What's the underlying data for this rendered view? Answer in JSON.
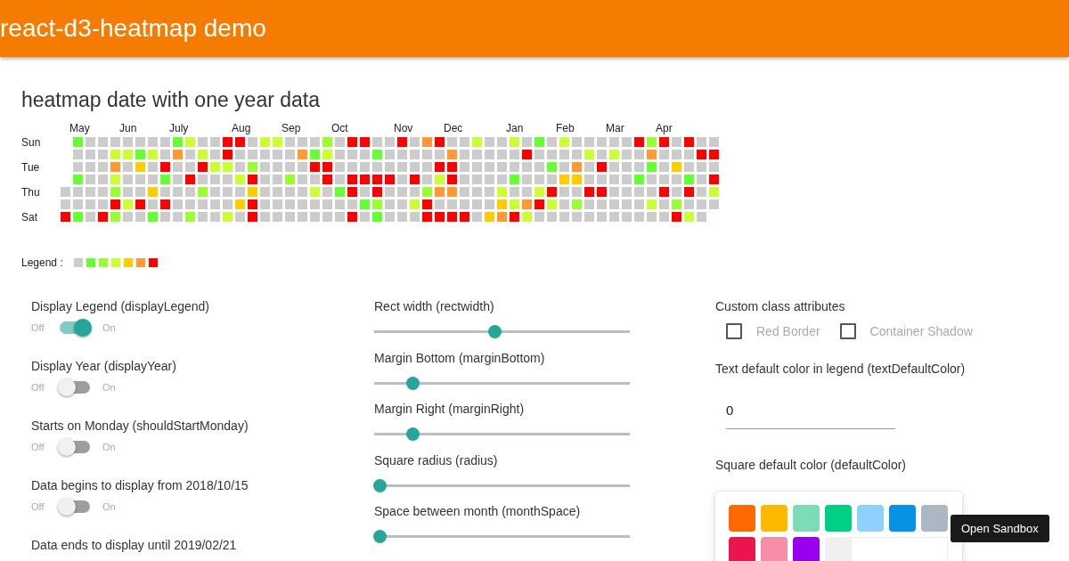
{
  "header": {
    "title": "react-d3-heatmap demo"
  },
  "section_title": "heatmap date with one year data",
  "heatmap": {
    "months": [
      {
        "label": "May"
      },
      {
        "label": "Jun"
      },
      {
        "label": "July"
      },
      {
        "label": "Aug"
      },
      {
        "label": "Sep"
      },
      {
        "label": "Oct"
      },
      {
        "label": "Nov"
      },
      {
        "label": "Dec"
      },
      {
        "label": "Jan"
      },
      {
        "label": "Feb"
      },
      {
        "label": "Mar"
      },
      {
        "label": "Apr"
      }
    ],
    "day_labels": [
      {
        "label": "Sun"
      },
      {
        "label": "Tue"
      },
      {
        "label": "Thu"
      },
      {
        "label": "Sat"
      }
    ],
    "rows": [
      {
        "cells": [
          {
            "color": "#66ff33"
          },
          {
            "color": "#cccccc"
          },
          {
            "color": "#cccccc"
          },
          {
            "color": "#cccccc"
          },
          {
            "color": "#cccccc"
          },
          {
            "color": "#cccccc"
          },
          {
            "color": "#cccccc"
          },
          {
            "color": "#cccccc"
          },
          {
            "color": "#66ff33"
          },
          {
            "color": "#ccff33"
          },
          {
            "color": "#cccccc"
          },
          {
            "color": "#cccccc"
          },
          {
            "color": "#ff0000"
          },
          {
            "color": "#ff0000"
          },
          {
            "color": "#cccccc"
          },
          {
            "color": "#ccff33"
          },
          {
            "color": "#ccff33"
          },
          {
            "color": "#cccccc"
          },
          {
            "color": "#cccccc"
          },
          {
            "color": "#cccccc"
          },
          {
            "color": "#99ff33"
          },
          {
            "color": "#cccccc"
          },
          {
            "color": "#ff0000"
          },
          {
            "color": "#ff0000"
          },
          {
            "color": "#cccccc"
          },
          {
            "color": "#cccccc"
          },
          {
            "color": "#ff0000"
          },
          {
            "color": "#cccccc"
          },
          {
            "color": "#ff9933"
          },
          {
            "color": "#ff0000"
          },
          {
            "color": "#cccccc"
          },
          {
            "color": "#cccccc"
          },
          {
            "color": "#ccff33"
          },
          {
            "color": "#cccccc"
          },
          {
            "color": "#cccccc"
          },
          {
            "color": "#ccff33"
          },
          {
            "color": "#cccccc"
          },
          {
            "color": "#66ff33"
          },
          {
            "color": "#cccccc"
          },
          {
            "color": "#ccff33"
          },
          {
            "color": "#cccccc"
          },
          {
            "color": "#cccccc"
          },
          {
            "color": "#cccccc"
          },
          {
            "color": "#cccccc"
          },
          {
            "color": "#cccccc"
          },
          {
            "color": "#ff0000"
          },
          {
            "color": "#99ff33"
          },
          {
            "color": "#ff0000"
          },
          {
            "color": "#cccccc"
          },
          {
            "color": "#ff0000"
          },
          {
            "color": "#cccccc"
          },
          {
            "color": "#cccccc"
          }
        ]
      },
      {
        "cells": [
          {
            "color": "#cccccc"
          },
          {
            "color": "#cccccc"
          },
          {
            "color": "#cccccc"
          },
          {
            "color": "#ccff33"
          },
          {
            "color": "#ccff33"
          },
          {
            "color": "#66ff33"
          },
          {
            "color": "#ccff33"
          },
          {
            "color": "#cccccc"
          },
          {
            "color": "#ff9933"
          },
          {
            "color": "#cccccc"
          },
          {
            "color": "#ccff33"
          },
          {
            "color": "#cccccc"
          },
          {
            "color": "#ff0000"
          },
          {
            "color": "#cccccc"
          },
          {
            "color": "#cccccc"
          },
          {
            "color": "#cccccc"
          },
          {
            "color": "#cccccc"
          },
          {
            "color": "#cccccc"
          },
          {
            "color": "#ff9933"
          },
          {
            "color": "#66ff33"
          },
          {
            "color": "#ccff33"
          },
          {
            "color": "#cccccc"
          },
          {
            "color": "#cccccc"
          },
          {
            "color": "#cccccc"
          },
          {
            "color": "#66ff33"
          },
          {
            "color": "#cccccc"
          },
          {
            "color": "#cccccc"
          },
          {
            "color": "#cccccc"
          },
          {
            "color": "#cccccc"
          },
          {
            "color": "#cccccc"
          },
          {
            "color": "#ff9933"
          },
          {
            "color": "#cccccc"
          },
          {
            "color": "#cccccc"
          },
          {
            "color": "#cccccc"
          },
          {
            "color": "#cccccc"
          },
          {
            "color": "#cccccc"
          },
          {
            "color": "#ff0000"
          },
          {
            "color": "#cccccc"
          },
          {
            "color": "#cccccc"
          },
          {
            "color": "#cccccc"
          },
          {
            "color": "#cccccc"
          },
          {
            "color": "#ccff33"
          },
          {
            "color": "#cccccc"
          },
          {
            "color": "#ccff33"
          },
          {
            "color": "#cccccc"
          },
          {
            "color": "#cccccc"
          },
          {
            "color": "#ff9933"
          },
          {
            "color": "#cccccc"
          },
          {
            "color": "#cccccc"
          },
          {
            "color": "#cccccc"
          },
          {
            "color": "#ff0000"
          },
          {
            "color": "#ff0000"
          }
        ]
      },
      {
        "cells": [
          {
            "color": "#cccccc"
          },
          {
            "color": "#cccccc"
          },
          {
            "color": "#cccccc"
          },
          {
            "color": "#ff9933"
          },
          {
            "color": "#cccccc"
          },
          {
            "color": "#ffcc00"
          },
          {
            "color": "#cccccc"
          },
          {
            "color": "#ff0000"
          },
          {
            "color": "#cccccc"
          },
          {
            "color": "#cccccc"
          },
          {
            "color": "#ff0000"
          },
          {
            "color": "#ccff33"
          },
          {
            "color": "#ccff33"
          },
          {
            "color": "#cccccc"
          },
          {
            "color": "#99ff33"
          },
          {
            "color": "#cccccc"
          },
          {
            "color": "#cccccc"
          },
          {
            "color": "#cccccc"
          },
          {
            "color": "#cccccc"
          },
          {
            "color": "#ff0000"
          },
          {
            "color": "#ff0000"
          },
          {
            "color": "#cccccc"
          },
          {
            "color": "#cccccc"
          },
          {
            "color": "#cccccc"
          },
          {
            "color": "#cccccc"
          },
          {
            "color": "#cccccc"
          },
          {
            "color": "#cccccc"
          },
          {
            "color": "#cccccc"
          },
          {
            "color": "#cccccc"
          },
          {
            "color": "#ff0000"
          },
          {
            "color": "#ff0000"
          },
          {
            "color": "#cccccc"
          },
          {
            "color": "#cccccc"
          },
          {
            "color": "#cccccc"
          },
          {
            "color": "#cccccc"
          },
          {
            "color": "#cccccc"
          },
          {
            "color": "#cccccc"
          },
          {
            "color": "#cccccc"
          },
          {
            "color": "#66ff33"
          },
          {
            "color": "#cccccc"
          },
          {
            "color": "#ff9933"
          },
          {
            "color": "#cccccc"
          },
          {
            "color": "#ff0000"
          },
          {
            "color": "#cccccc"
          },
          {
            "color": "#cccccc"
          },
          {
            "color": "#cccccc"
          },
          {
            "color": "#66ff33"
          },
          {
            "color": "#cccccc"
          },
          {
            "color": "#ffcc00"
          },
          {
            "color": "#cccccc"
          },
          {
            "color": "#cccccc"
          },
          {
            "color": "#cccccc"
          }
        ]
      },
      {
        "cells": [
          {
            "color": "#66ff33"
          },
          {
            "color": "#cccccc"
          },
          {
            "color": "#cccccc"
          },
          {
            "color": "#ccff33"
          },
          {
            "color": "#cccccc"
          },
          {
            "color": "#cccccc"
          },
          {
            "color": "#cccccc"
          },
          {
            "color": "#66ff33"
          },
          {
            "color": "#cccccc"
          },
          {
            "color": "#ff0000"
          },
          {
            "color": "#cccccc"
          },
          {
            "color": "#cccccc"
          },
          {
            "color": "#cccccc"
          },
          {
            "color": "#ccff33"
          },
          {
            "color": "#ff0000"
          },
          {
            "color": "#cccccc"
          },
          {
            "color": "#cccccc"
          },
          {
            "color": "#99ff33"
          },
          {
            "color": "#cccccc"
          },
          {
            "color": "#cccccc"
          },
          {
            "color": "#ff0000"
          },
          {
            "color": "#cccccc"
          },
          {
            "color": "#ff0000"
          },
          {
            "color": "#ff0000"
          },
          {
            "color": "#ff0000"
          },
          {
            "color": "#ff0000"
          },
          {
            "color": "#cccccc"
          },
          {
            "color": "#ff0000"
          },
          {
            "color": "#cccccc"
          },
          {
            "color": "#ccff33"
          },
          {
            "color": "#ff0000"
          },
          {
            "color": "#cccccc"
          },
          {
            "color": "#cccccc"
          },
          {
            "color": "#cccccc"
          },
          {
            "color": "#cccccc"
          },
          {
            "color": "#66ff33"
          },
          {
            "color": "#cccccc"
          },
          {
            "color": "#cccccc"
          },
          {
            "color": "#cccccc"
          },
          {
            "color": "#ffcc00"
          },
          {
            "color": "#ffcc00"
          },
          {
            "color": "#cccccc"
          },
          {
            "color": "#cccccc"
          },
          {
            "color": "#cccccc"
          },
          {
            "color": "#cccccc"
          },
          {
            "color": "#66ff33"
          },
          {
            "color": "#cccccc"
          },
          {
            "color": "#cccccc"
          },
          {
            "color": "#cccccc"
          },
          {
            "color": "#66ff33"
          },
          {
            "color": "#cccccc"
          },
          {
            "color": "#ff0000"
          }
        ]
      },
      {
        "cells": [
          {
            "color": "#cccccc"
          },
          {
            "color": "#cccccc"
          },
          {
            "color": "#cccccc"
          },
          {
            "color": "#cccccc"
          },
          {
            "color": "#99ff33"
          },
          {
            "color": "#cccccc"
          },
          {
            "color": "#cccccc"
          },
          {
            "color": "#ffcc00"
          },
          {
            "color": "#cccccc"
          },
          {
            "color": "#cccccc"
          },
          {
            "color": "#cccccc"
          },
          {
            "color": "#99ff33"
          },
          {
            "color": "#cccccc"
          },
          {
            "color": "#cccccc"
          },
          {
            "color": "#cccccc"
          },
          {
            "color": "#ffcc00"
          },
          {
            "color": "#cccccc"
          },
          {
            "color": "#cccccc"
          },
          {
            "color": "#cccccc"
          },
          {
            "color": "#cccccc"
          },
          {
            "color": "#ccff33"
          },
          {
            "color": "#cccccc"
          },
          {
            "color": "#66ff33"
          },
          {
            "color": "#ff0000"
          },
          {
            "color": "#cccccc"
          },
          {
            "color": "#ff0000"
          },
          {
            "color": "#cccccc"
          },
          {
            "color": "#cccccc"
          },
          {
            "color": "#cccccc"
          },
          {
            "color": "#99ff33"
          },
          {
            "color": "#ff9933"
          },
          {
            "color": "#ff9933"
          },
          {
            "color": "#cccccc"
          },
          {
            "color": "#cccccc"
          },
          {
            "color": "#cccccc"
          },
          {
            "color": "#ccff33"
          },
          {
            "color": "#cccccc"
          },
          {
            "color": "#cccccc"
          },
          {
            "color": "#ccff33"
          },
          {
            "color": "#ff0000"
          },
          {
            "color": "#cccccc"
          },
          {
            "color": "#cccccc"
          },
          {
            "color": "#ff0000"
          },
          {
            "color": "#ff0000"
          },
          {
            "color": "#cccccc"
          },
          {
            "color": "#cccccc"
          },
          {
            "color": "#cccccc"
          },
          {
            "color": "#cccccc"
          },
          {
            "color": "#ff0000"
          },
          {
            "color": "#cccccc"
          },
          {
            "color": "#ff0000"
          },
          {
            "color": "#cccccc"
          },
          {
            "color": "#ccff33"
          }
        ]
      },
      {
        "cells": [
          {
            "color": "#cccccc"
          },
          {
            "color": "#cccccc"
          },
          {
            "color": "#cccccc"
          },
          {
            "color": "#cccccc"
          },
          {
            "color": "#ff0000"
          },
          {
            "color": "#ccff33"
          },
          {
            "color": "#ff0000"
          },
          {
            "color": "#cccccc"
          },
          {
            "color": "#ff0000"
          },
          {
            "color": "#cccccc"
          },
          {
            "color": "#cccccc"
          },
          {
            "color": "#cccccc"
          },
          {
            "color": "#cccccc"
          },
          {
            "color": "#cccccc"
          },
          {
            "color": "#ffcc00"
          },
          {
            "color": "#ff0000"
          },
          {
            "color": "#cccccc"
          },
          {
            "color": "#cccccc"
          },
          {
            "color": "#cccccc"
          },
          {
            "color": "#cccccc"
          },
          {
            "color": "#cccccc"
          },
          {
            "color": "#cccccc"
          },
          {
            "color": "#cccccc"
          },
          {
            "color": "#cccccc"
          },
          {
            "color": "#66ff33"
          },
          {
            "color": "#99ff33"
          },
          {
            "color": "#cccccc"
          },
          {
            "color": "#cccccc"
          },
          {
            "color": "#ccff33"
          },
          {
            "color": "#ff0000"
          },
          {
            "color": "#cccccc"
          },
          {
            "color": "#cccccc"
          },
          {
            "color": "#cccccc"
          },
          {
            "color": "#cccccc"
          },
          {
            "color": "#cccccc"
          },
          {
            "color": "#ffcc00"
          },
          {
            "color": "#ccff33"
          },
          {
            "color": "#ff9933"
          },
          {
            "color": "#ff0000"
          },
          {
            "color": "#ccff33"
          },
          {
            "color": "#cccccc"
          },
          {
            "color": "#99ff33"
          },
          {
            "color": "#cccccc"
          },
          {
            "color": "#cccccc"
          },
          {
            "color": "#cccccc"
          },
          {
            "color": "#cccccc"
          },
          {
            "color": "#cccccc"
          },
          {
            "color": "#ccff33"
          },
          {
            "color": "#cccccc"
          },
          {
            "color": "#99ff33"
          },
          {
            "color": "#cccccc"
          },
          {
            "color": "#cccccc"
          },
          {
            "color": "#cccccc"
          }
        ]
      },
      {
        "cells": [
          {
            "color": "#ff0000"
          },
          {
            "color": "#66ff33"
          },
          {
            "color": "#cccccc"
          },
          {
            "color": "#ff0000"
          },
          {
            "color": "#99ff33"
          },
          {
            "color": "#cccccc"
          },
          {
            "color": "#cccccc"
          },
          {
            "color": "#66ff33"
          },
          {
            "color": "#cccccc"
          },
          {
            "color": "#cccccc"
          },
          {
            "color": "#99ff33"
          },
          {
            "color": "#cccccc"
          },
          {
            "color": "#cccccc"
          },
          {
            "color": "#ccff33"
          },
          {
            "color": "#cccccc"
          },
          {
            "color": "#ff0000"
          },
          {
            "color": "#cccccc"
          },
          {
            "color": "#cccccc"
          },
          {
            "color": "#cccccc"
          },
          {
            "color": "#cccccc"
          },
          {
            "color": "#cccccc"
          },
          {
            "color": "#cccccc"
          },
          {
            "color": "#cccccc"
          },
          {
            "color": "#ff0000"
          },
          {
            "color": "#cccccc"
          },
          {
            "color": "#66ff33"
          },
          {
            "color": "#cccccc"
          },
          {
            "color": "#cccccc"
          },
          {
            "color": "#cccccc"
          },
          {
            "color": "#ff0000"
          },
          {
            "color": "#ff0000"
          },
          {
            "color": "#ff0000"
          },
          {
            "color": "#ff0000"
          },
          {
            "color": "#cccccc"
          },
          {
            "color": "#ffcc00"
          },
          {
            "color": "#ff9933"
          },
          {
            "color": "#ff0000"
          },
          {
            "color": "#ccff33"
          },
          {
            "color": "#cccccc"
          },
          {
            "color": "#cccccc"
          },
          {
            "color": "#cccccc"
          },
          {
            "color": "#cccccc"
          },
          {
            "color": "#cccccc"
          },
          {
            "color": "#cccccc"
          },
          {
            "color": "#cccccc"
          },
          {
            "color": "#cccccc"
          },
          {
            "color": "#cccccc"
          },
          {
            "color": "#cccccc"
          },
          {
            "color": "#cccccc"
          },
          {
            "color": "#ff0000"
          },
          {
            "color": "#ccff33"
          },
          {
            "color": "#cccccc"
          }
        ]
      }
    ]
  },
  "legend": {
    "label": "Legend :",
    "colors": [
      {
        "color": "#cccccc"
      },
      {
        "color": "#66ff33"
      },
      {
        "color": "#99ff33"
      },
      {
        "color": "#ccff33"
      },
      {
        "color": "#ffcc00"
      },
      {
        "color": "#ff9933"
      },
      {
        "color": "#ff0000"
      }
    ]
  },
  "toggles": [
    {
      "label": "Display Legend (displayLegend)",
      "off": "Off",
      "on_label": "On",
      "on": true
    },
    {
      "label": "Display Year (displayYear)",
      "off": "Off",
      "on_label": "On",
      "on": false
    },
    {
      "label": "Starts on Monday (shouldStartMonday)",
      "off": "Off",
      "on_label": "On",
      "on": false
    },
    {
      "label": "Data begins to display from 2018/10/15",
      "off": "Off",
      "on_label": "On",
      "on": false
    },
    {
      "label": "Data ends to display until 2019/02/21"
    }
  ],
  "sliders": [
    {
      "label": "Rect width (rectwidth)",
      "level": 0.45
    },
    {
      "label": "Margin Bottom (marginBottom)",
      "level": 0.13
    },
    {
      "label": "Margin Right (marginRight)",
      "level": 0.13
    },
    {
      "label": "Square radius (radius)",
      "level": 0
    },
    {
      "label": "Space between month (monthSpace)",
      "level": 0
    }
  ],
  "custom_class": {
    "label": "Custom class attributes",
    "checkboxes": [
      {
        "label": "Red Border",
        "checked": false
      },
      {
        "label": "Container Shadow",
        "checked": false
      }
    ]
  },
  "text_color": {
    "label": "Text default color in legend (textDefaultColor)",
    "value": "0"
  },
  "default_color": {
    "label": "Square default color (defaultColor)",
    "swatches": [
      {
        "color": "#ff6900"
      },
      {
        "color": "#fcb900"
      },
      {
        "color": "#7bdcb5"
      },
      {
        "color": "#00d084"
      },
      {
        "color": "#8ed1fc"
      },
      {
        "color": "#0693e3"
      },
      {
        "color": "#abb8c3"
      },
      {
        "color": "#eb144c"
      },
      {
        "color": "#f78da7"
      },
      {
        "color": "#9900ef"
      }
    ]
  },
  "tooltip": "Open Sandbox"
}
